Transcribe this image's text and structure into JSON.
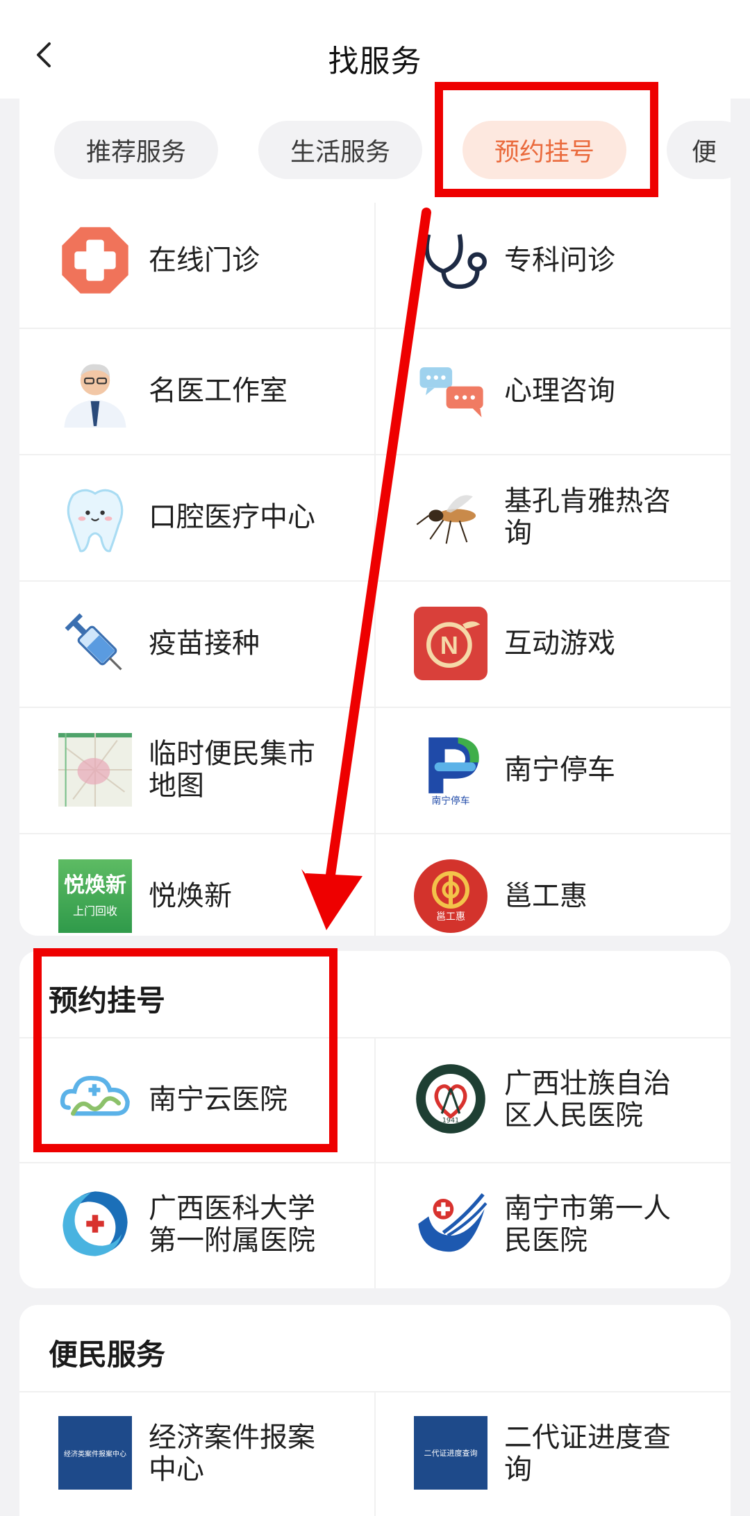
{
  "header": {
    "title": "找服务",
    "back_icon": "chevron-left-icon"
  },
  "tabs": [
    {
      "label": "推荐服务",
      "active": false
    },
    {
      "label": "生活服务",
      "active": false
    },
    {
      "label": "预约挂号",
      "active": true
    },
    {
      "label": "便",
      "active": false
    }
  ],
  "services": [
    {
      "label": "在线门诊",
      "icon": "medical-cross-icon"
    },
    {
      "label": "专科问诊",
      "icon": "stethoscope-icon"
    },
    {
      "label": "名医工作室",
      "icon": "doctor-avatar-icon"
    },
    {
      "label": "心理咨询",
      "icon": "chat-bubbles-icon"
    },
    {
      "label": "口腔医疗中心",
      "icon": "tooth-icon"
    },
    {
      "label": "基孔肯雅热咨询",
      "icon": "mosquito-icon"
    },
    {
      "label": "疫苗接种",
      "icon": "syringe-icon"
    },
    {
      "label": "互动游戏",
      "icon": "n-game-icon"
    },
    {
      "label": "临时便民集市地图",
      "icon": "map-thumbnail-icon"
    },
    {
      "label": "南宁停车",
      "icon": "parking-icon"
    },
    {
      "label": "悦焕新",
      "icon": "yuehuanxin-icon",
      "icon_text": "悦焕新",
      "icon_subtext": "上门回收"
    },
    {
      "label": "邕工惠",
      "icon": "union-emblem-icon",
      "icon_text": "邕工惠"
    }
  ],
  "appointment": {
    "title": "预约挂号",
    "items": [
      {
        "label": "南宁云医院",
        "icon": "cloud-hospital-icon"
      },
      {
        "label": "广西壮族自治区人民医院",
        "icon": "hospital-seal-icon",
        "icon_text": "1941"
      },
      {
        "label": "广西医科大学第一附属医院",
        "icon": "swirl-cross-icon"
      },
      {
        "label": "南宁市第一人民医院",
        "icon": "bird-cross-icon"
      }
    ]
  },
  "convenience": {
    "title": "便民服务",
    "items": [
      {
        "label": "经济案件报案中心",
        "icon": "blue-square-icon",
        "icon_text": "经济类案件报案中心"
      },
      {
        "label": "二代证进度查询",
        "icon": "blue-square-icon",
        "icon_text": "二代证进度查询"
      }
    ]
  },
  "colors": {
    "accent": "#ea6a3c",
    "annotation": "#ee0000"
  }
}
